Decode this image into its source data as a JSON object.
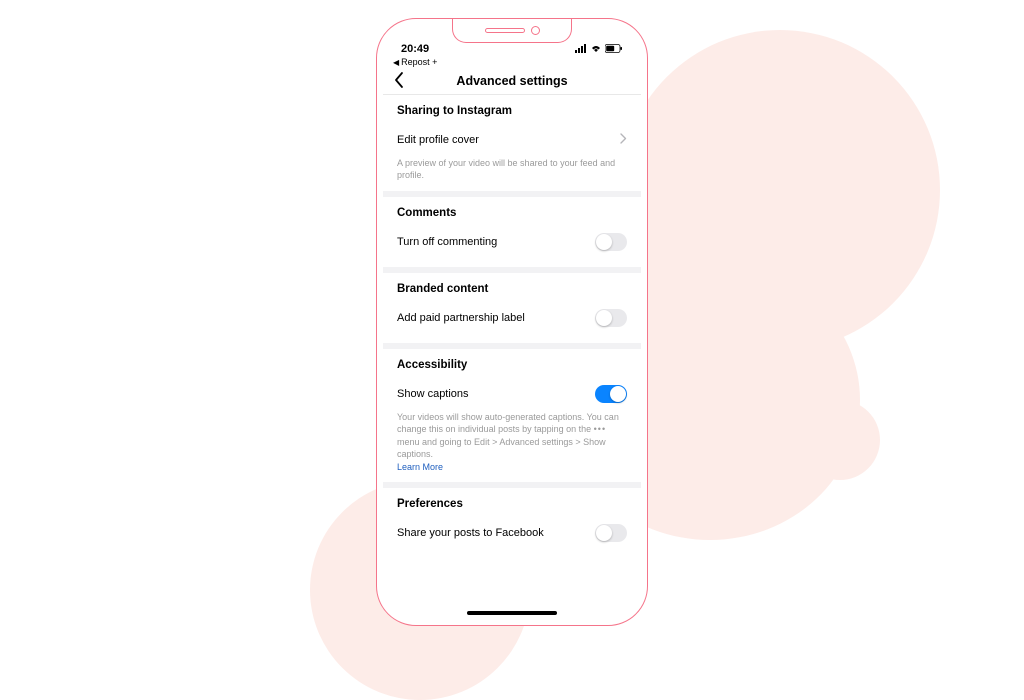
{
  "status": {
    "time": "20:49",
    "back_app_label": "Repost +"
  },
  "nav": {
    "title": "Advanced settings"
  },
  "sections": {
    "sharing": {
      "title": "Sharing to Instagram",
      "row_label": "Edit profile cover",
      "hint": "A preview of your video will be shared to your feed and profile."
    },
    "comments": {
      "title": "Comments",
      "row_label": "Turn off commenting"
    },
    "branded": {
      "title": "Branded content",
      "row_label": "Add paid partnership label"
    },
    "accessibility": {
      "title": "Accessibility",
      "row_label": "Show captions",
      "hint_1": "Your videos will show auto-generated captions. You can change this on individual posts by tapping on the ",
      "hint_2": "menu and going to Edit > Advanced settings > Show captions.",
      "link": "Learn More"
    },
    "preferences": {
      "title": "Preferences",
      "row_label": "Share your posts to Facebook"
    }
  },
  "toggles": {
    "comments_off": false,
    "paid_partnership": false,
    "show_captions": true,
    "share_fb": false
  }
}
